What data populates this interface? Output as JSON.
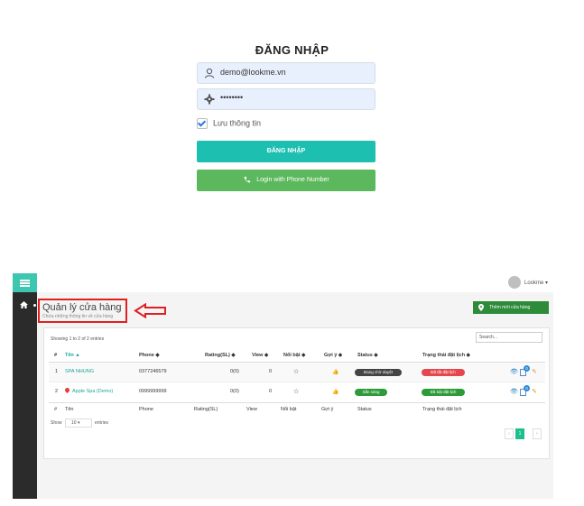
{
  "login": {
    "title": "ĐĂNG NHẬP",
    "email_value": "demo@lookme.vn",
    "password_mask": "••••••••",
    "remember_label": "Lưu thông tin",
    "submit_label": "ĐĂNG NHẬP",
    "phone_button_label": "Login with Phone Number"
  },
  "admin": {
    "user_label": "Lookme",
    "page_title": "Quản lý cửa hàng",
    "page_subtitle": "Chứa những thông tin về cửa hàng",
    "add_button_label": "Thêm mới cửa hàng",
    "showing_text": "Showing 1 to 2 of 2 entries",
    "search_placeholder": "Search...",
    "table_headers": [
      "#",
      "Tên",
      "Phone",
      "Rating(SL)",
      "View",
      "Nổi bật",
      "Gợi ý",
      "Status",
      "Trạng thái đặt lịch"
    ],
    "table_footer": [
      "#",
      "Tên",
      "Phone",
      "Rating(SL)",
      "View",
      "Nổi bật",
      "Gợi ý",
      "Status",
      "Trạng thái đặt lịch"
    ],
    "rows": [
      {
        "index": "1",
        "name": "SPA NHUNG",
        "phone": "0377246579",
        "rating": "0(0)",
        "view": "0",
        "status": "Đang chờ duyệt",
        "booking": "Đã tắt đặt lịch",
        "badge_count": "0"
      },
      {
        "index": "2",
        "name": "Apple Spa (Demo)",
        "phone": "0999999999",
        "rating": "0(0)",
        "view": "0",
        "status": "Sẵn sàng",
        "booking": "Đã bật đặt lịch",
        "badge_count": "0"
      }
    ],
    "show_label": "Show",
    "show_value": "10",
    "entries_label": "entries",
    "pagination": {
      "prev": "‹",
      "current": "1",
      "next": "›"
    },
    "colors": {
      "teal": "#1dbfb1",
      "green": "#5cb85c",
      "dark_green": "#2e8b3a",
      "red": "#e02020",
      "status_dark": "#444444",
      "status_red": "#e5474f",
      "status_green": "#2e9b3a"
    }
  }
}
